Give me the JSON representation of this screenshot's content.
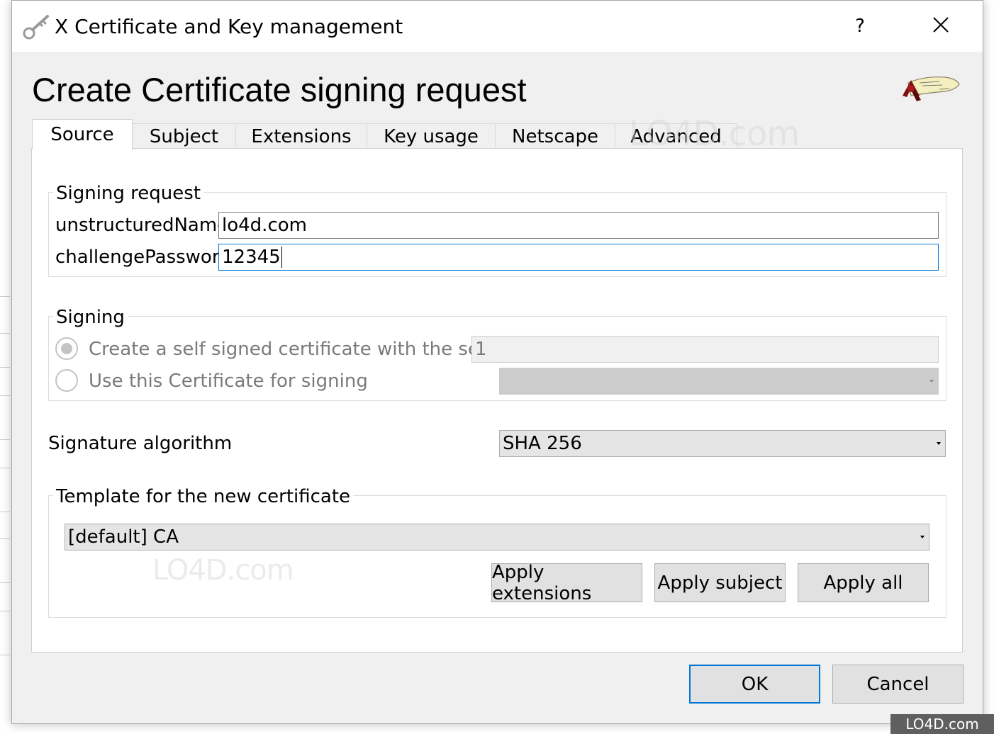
{
  "window": {
    "title": "X Certificate and Key management",
    "help_label": "?",
    "close_label": "×"
  },
  "page": {
    "heading": "Create Certificate signing request"
  },
  "tabs": [
    {
      "label": "Source",
      "active": true
    },
    {
      "label": "Subject",
      "active": false
    },
    {
      "label": "Extensions",
      "active": false
    },
    {
      "label": "Key usage",
      "active": false
    },
    {
      "label": "Netscape",
      "active": false
    },
    {
      "label": "Advanced",
      "active": false
    }
  ],
  "signing_request": {
    "title": "Signing request",
    "unstructured_name_label": "unstructuredName",
    "unstructured_name_value": "lo4d.com",
    "challenge_password_label": "challengePassword",
    "challenge_password_value": "12345"
  },
  "signing": {
    "title": "Signing",
    "self_signed_label": "Create a self signed certificate with the serial",
    "serial_value": "1",
    "use_cert_label": "Use this Certificate for signing",
    "use_cert_value": ""
  },
  "signature_algorithm": {
    "label": "Signature algorithm",
    "value": "SHA 256"
  },
  "template": {
    "title": "Template for the new certificate",
    "value": "[default] CA",
    "apply_extensions": "Apply extensions",
    "apply_subject": "Apply subject",
    "apply_all": "Apply all"
  },
  "footer": {
    "ok": "OK",
    "cancel": "Cancel"
  },
  "watermark": {
    "text": "LO4D.com"
  },
  "colors": {
    "focus_blue": "#0078d7",
    "dialog_bg": "#f0f0f0",
    "button_bg": "#e1e1e1"
  }
}
